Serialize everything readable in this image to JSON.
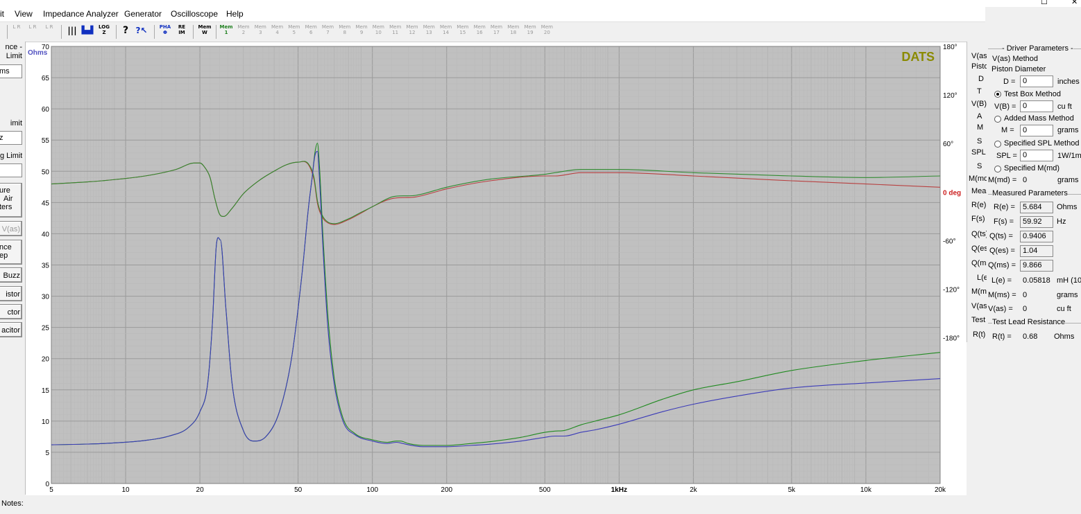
{
  "window": {
    "title_fragment": "",
    "maximize_glyph": "☐",
    "close_glyph": "✕"
  },
  "menu": [
    "it",
    "View",
    "Impedance Analyzer",
    "Generator",
    "Oscilloscope",
    "Help"
  ],
  "toolbar": {
    "buttons": [
      {
        "label": "L R",
        "icon": "channel-icon"
      },
      {
        "label": "L R",
        "icon": "channel-icon"
      },
      {
        "label": "L R",
        "icon": "channel-icon"
      },
      {
        "label": "|||",
        "icon": "piano-icon"
      },
      {
        "label": "▙▟",
        "icon": "bar-graph-icon"
      },
      {
        "label": "LOG Z",
        "icon": "log-z-icon"
      },
      {
        "label": "?",
        "icon": "help-icon"
      },
      {
        "label": "?↖",
        "icon": "context-help-icon"
      },
      {
        "label": "PHA Φ",
        "icon": "phase-icon"
      },
      {
        "label": "RE IM",
        "icon": "re-im-icon"
      },
      {
        "label": "Mem W",
        "icon": "memory-write-icon"
      },
      {
        "label": "Mem 1",
        "icon": "memory-slot-icon"
      }
    ],
    "mem_slots": [
      "Mem 2",
      "Mem 3",
      "Mem 4",
      "Mem 5",
      "Mem 6",
      "Mem 7",
      "Mem 8",
      "Mem 9",
      "Mem 10",
      "Mem 11",
      "Mem 12",
      "Mem 13",
      "Mem 14",
      "Mem 15",
      "Mem 16",
      "Mem 17",
      "Mem 18",
      "Mem 19",
      "Mem 20"
    ]
  },
  "left_panel": {
    "group1": {
      "line1": "nce -",
      "line2": "Limit",
      "field": "ms"
    },
    "group2": {
      "label": "imit",
      "field": "z"
    },
    "group3": {
      "label": "g Limit",
      "field": ""
    },
    "btn_air": {
      "line1": "ure",
      "line2": "Air",
      "line3": "ters"
    },
    "btn_vas": "V(as)",
    "btn_sweep": {
      "line1": "nce",
      "line2": "ep"
    },
    "btn_buzz": "Buzz",
    "btn_resistor": "istor",
    "btn_inductor": "ctor",
    "btn_capacitor": "acitor"
  },
  "notes_label": "Notes:",
  "mid_panel": {
    "lines": [
      "V(as",
      "Pisto",
      "D",
      "T",
      "V(B)",
      "A",
      "M",
      "S",
      "SPL",
      "S",
      "M(md",
      "Meas",
      "R(e)",
      "F(s)",
      "Q(ts)",
      "Q(es",
      "Q(ms",
      "L(e)",
      "M(ms",
      "V(as)",
      "Test",
      "R(t)"
    ]
  },
  "driver_parameters": {
    "title": "- Driver Parameters -",
    "method_label": "V(as) Method",
    "piston_diameter_label": "Piston Diameter",
    "d": {
      "label": "D =",
      "value": "0",
      "unit": "inches"
    },
    "test_box_method": {
      "label": "Test Box Method",
      "selected": true
    },
    "vb": {
      "label": "V(B) =",
      "value": "0",
      "unit": "cu ft"
    },
    "added_mass_method": {
      "label": "Added Mass Method",
      "selected": false
    },
    "m": {
      "label": "M =",
      "value": "0",
      "unit": "grams"
    },
    "specified_spl_method": {
      "label": "Specified SPL Method",
      "selected": false
    },
    "spl": {
      "label": "SPL =",
      "value": "0",
      "unit": "1W/1m"
    },
    "specified_mmd": {
      "label": "Specified M(md)",
      "selected": false
    },
    "mmd": {
      "label": "M(md) =",
      "value": "0",
      "unit": "grams"
    }
  },
  "measured_parameters": {
    "title": "Measured Parameters",
    "re": {
      "label": "R(e) =",
      "value": "5.684",
      "unit": "Ohms"
    },
    "fs": {
      "label": "F(s) =",
      "value": "59.92",
      "unit": "Hz"
    },
    "qts": {
      "label": "Q(ts) =",
      "value": "0.9406"
    },
    "qes": {
      "label": "Q(es) =",
      "value": "1.04"
    },
    "qms": {
      "label": "Q(ms) =",
      "value": "9.866"
    },
    "le": {
      "label": "L(e) =",
      "value": "0.05818",
      "unit": "mH (10"
    },
    "mms": {
      "label": "M(ms) =",
      "value": "0",
      "unit": "grams"
    },
    "vas": {
      "label": "V(as) =",
      "value": "0",
      "unit": "cu ft"
    }
  },
  "test_lead": {
    "title": "Test Lead Resistance",
    "rt": {
      "label": "R(t) =",
      "value": "0.68",
      "unit": "Ohms"
    }
  },
  "chart_data": {
    "type": "line",
    "watermark": "DATS",
    "x_scale": "log",
    "xlim": [
      5,
      20000
    ],
    "x_ticks": [
      {
        "v": 5,
        "t": "5"
      },
      {
        "v": 10,
        "t": "10"
      },
      {
        "v": 20,
        "t": "20"
      },
      {
        "v": 50,
        "t": "50"
      },
      {
        "v": 100,
        "t": "100"
      },
      {
        "v": 200,
        "t": "200"
      },
      {
        "v": 500,
        "t": "500"
      },
      {
        "v": 1000,
        "t": "1kHz"
      },
      {
        "v": 2000,
        "t": "2k"
      },
      {
        "v": 5000,
        "t": "5k"
      },
      {
        "v": 10000,
        "t": "10k"
      },
      {
        "v": 20000,
        "t": "20k"
      }
    ],
    "ylabel": "Ohms",
    "ylim": [
      0,
      70
    ],
    "y_ticks": [
      0,
      5,
      10,
      15,
      20,
      25,
      30,
      35,
      40,
      45,
      50,
      55,
      60,
      65,
      70
    ],
    "y2label": "deg",
    "y2lim": [
      -360,
      180
    ],
    "y2_ticks": [
      {
        "v": 180,
        "t": "180°"
      },
      {
        "v": 120,
        "t": "120°"
      },
      {
        "v": 60,
        "t": "60°"
      },
      {
        "v": 0,
        "t": "0 deg"
      },
      {
        "v": -60,
        "t": "-60°"
      },
      {
        "v": -120,
        "t": "-120°"
      },
      {
        "v": -180,
        "t": "-180°"
      }
    ],
    "grid": true,
    "colors": {
      "background": "#ffffff",
      "plot": "#c0c0c0",
      "grid_major": "#9a9a9a",
      "grid_minor": "#b4b4b4",
      "axis_label": "#5050c0",
      "deg_label": "#cc2020",
      "watermark": "#8a8a00"
    },
    "series": [
      {
        "color": "#3b3bb8",
        "axis": "left",
        "x": [
          5,
          8,
          12,
          15,
          18,
          20,
          21.5,
          22.5,
          23.3,
          24.2,
          25.5,
          27,
          30,
          33,
          37,
          42,
          47,
          52,
          55,
          57,
          58.5,
          59.9,
          61,
          63,
          66,
          70,
          76,
          85,
          100,
          115,
          125,
          130,
          140,
          160,
          200,
          250,
          300,
          400,
          500,
          550,
          600,
          700,
          800,
          1000,
          1500,
          2000,
          3000,
          5000,
          10000,
          20000
        ],
        "y": [
          6.2,
          6.4,
          6.9,
          7.6,
          9,
          11.5,
          16,
          26,
          38,
          39,
          28,
          16,
          8.5,
          6.8,
          7.5,
          11.5,
          20,
          34,
          44,
          49,
          52.5,
          53.2,
          49,
          38,
          25,
          16,
          10,
          7.8,
          6.8,
          6.4,
          6.6,
          6.5,
          6.2,
          5.9,
          5.9,
          6.1,
          6.3,
          6.8,
          7.4,
          7.6,
          7.6,
          8.2,
          8.6,
          9.5,
          11.5,
          12.7,
          14,
          15.3,
          16.1,
          16.8
        ]
      },
      {
        "color": "#208a20",
        "axis": "left",
        "x": [
          5,
          8,
          12,
          15,
          18,
          20,
          21.5,
          22.5,
          23.3,
          24.2,
          25.5,
          27,
          30,
          33,
          37,
          42,
          47,
          52,
          55,
          57,
          58.5,
          59.9,
          61,
          63,
          66,
          70,
          76,
          85,
          100,
          115,
          125,
          130,
          140,
          160,
          200,
          250,
          300,
          400,
          500,
          550,
          600,
          700,
          800,
          1000,
          1500,
          2000,
          3000,
          5000,
          10000,
          20000
        ],
        "y": [
          6.2,
          6.4,
          6.9,
          7.6,
          9,
          11.5,
          16,
          26,
          38,
          39,
          28,
          16,
          8.5,
          6.8,
          7.5,
          11.5,
          20,
          34,
          44,
          49,
          53,
          54.5,
          51,
          40,
          27,
          17,
          10.5,
          8,
          7,
          6.6,
          6.8,
          6.8,
          6.4,
          6.1,
          6.1,
          6.4,
          6.7,
          7.4,
          8.2,
          8.4,
          8.5,
          9.4,
          10,
          11,
          13.5,
          15,
          16.3,
          18.1,
          19.7,
          21
        ]
      },
      {
        "color": "#b84040",
        "axis": "right",
        "x": [
          5,
          8,
          12,
          16,
          19,
          20,
          21,
          22,
          23,
          24,
          25,
          27,
          30,
          35,
          40,
          45,
          50,
          55,
          58,
          60,
          63,
          66,
          70,
          80,
          90,
          100,
          120,
          150,
          200,
          300,
          500,
          550,
          700,
          1000,
          2000,
          5000,
          10000,
          20000
        ],
        "y": [
          10,
          14,
          20,
          28,
          36,
          36,
          30,
          18,
          -8,
          -27,
          -30,
          -20,
          -2,
          15,
          26,
          34,
          37,
          34,
          15,
          -15,
          -32,
          -38,
          -40,
          -34,
          -26,
          -18,
          -8,
          -6,
          4,
          14,
          20,
          20,
          24,
          24,
          20,
          14,
          10,
          6
        ]
      },
      {
        "color": "#308a30",
        "axis": "right",
        "x": [
          5,
          8,
          12,
          16,
          19,
          20,
          21,
          22,
          23,
          24,
          25,
          27,
          30,
          35,
          40,
          45,
          50,
          55,
          58,
          60,
          63,
          66,
          70,
          80,
          90,
          100,
          120,
          150,
          200,
          300,
          500,
          550,
          700,
          1000,
          2000,
          5000,
          10000,
          20000
        ],
        "y": [
          10,
          14,
          20,
          28,
          36,
          36,
          30,
          18,
          -8,
          -27,
          -30,
          -20,
          -2,
          15,
          26,
          34,
          37,
          35,
          18,
          -12,
          -30,
          -37,
          -39,
          -33,
          -25,
          -18,
          -6,
          -4,
          6,
          16,
          22,
          24,
          28,
          28,
          24,
          20,
          18,
          20
        ]
      }
    ]
  }
}
